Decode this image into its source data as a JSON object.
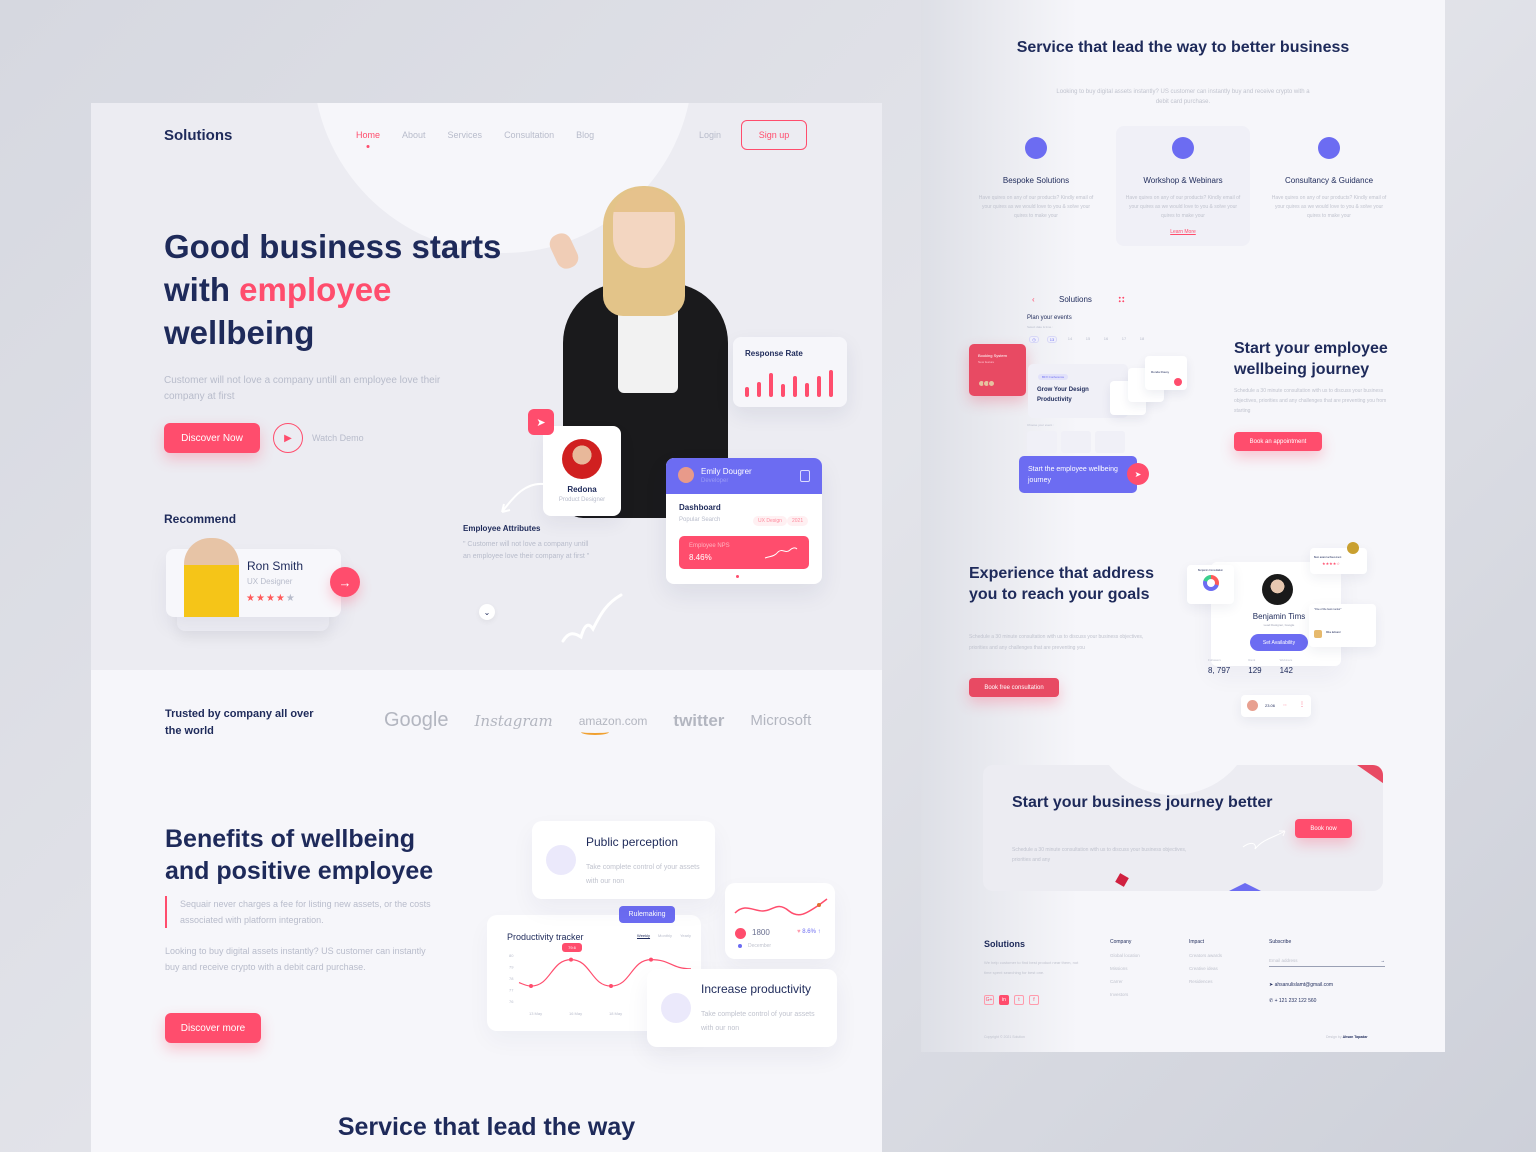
{
  "landing": {
    "logo": "Solutions",
    "nav": [
      {
        "label": "Home",
        "active": true
      },
      {
        "label": "About"
      },
      {
        "label": "Services"
      },
      {
        "label": "Consultation"
      },
      {
        "label": "Blog"
      }
    ],
    "login": "Login",
    "signup": "Sign up",
    "hero": {
      "title_part1": "Good business starts with ",
      "title_highlight": "employee",
      "title_part2": " wellbeing",
      "subtitle": "Customer will not love a company untill an employee love their company at first",
      "primary_button": "Discover Now",
      "watch_demo": "Watch Demo"
    },
    "recommend": {
      "heading": "Recommend",
      "name": "Ron Smith",
      "role": "UX Designer",
      "rating": 4,
      "rating_max": 5
    },
    "response_rate": {
      "title": "Response Rate",
      "bars": [
        0.35,
        0.55,
        0.85,
        0.45,
        0.75,
        0.5,
        0.75,
        0.95
      ]
    },
    "redona": {
      "name": "Redona",
      "role": "Product Designer"
    },
    "employee_attributes": {
      "title": "Employee Attributes",
      "text": "\" Customer will not love a company untill an employee love  their company at first \""
    },
    "emily_card": {
      "name": "Emily Dougrer",
      "role": "Developer",
      "section": "Dashboard",
      "popular": "Popular Search",
      "tags": [
        "UX Design",
        "2021"
      ],
      "nps_label": "Employee NPS",
      "nps_value": "8.46%"
    },
    "trusted": {
      "title": "Trusted by company all over the world",
      "brands": [
        "Google",
        "Instagram",
        "amazon.com",
        "twitter",
        "Microsoft"
      ]
    },
    "benefits": {
      "title": "Benefits of wellbeing and positive employee",
      "quote": "Sequair never charges a fee for listing new assets, or the costs associated with platform integration.",
      "text": "Looking to buy digital assets instantly? US customer can instantly buy and receive crypto with a debit card purchase.",
      "button": "Discover more",
      "public_perception": {
        "title": "Public perception",
        "text": "Take complete control of your assets with our non"
      },
      "rulemaking": "Rulemaking",
      "increase_productivity": {
        "title": "Increase productivity",
        "text": "Take complete control of your assets with our non"
      },
      "mini_stat": {
        "value": "1800",
        "change": "8.6%",
        "label": "December"
      }
    },
    "service_heading": "Service that lead the way"
  },
  "chart_data": {
    "type": "line",
    "title": "Productivity tracker",
    "tabs": [
      "Weekly",
      "Monthly",
      "Yearly"
    ],
    "active_tab": "Weekly",
    "x": [
      "13 May",
      "16 May",
      "18 May",
      "19 May"
    ],
    "y_ticks": [
      "80",
      "79",
      "78",
      "77",
      "76"
    ],
    "ylim": [
      76,
      80
    ],
    "series": [
      {
        "name": "Productivity",
        "values": [
          77.3,
          79.6,
          77.3,
          79.6,
          78.8
        ]
      }
    ],
    "highlight_label": "79.6"
  },
  "services": {
    "title": "Service that lead the way to better business",
    "subtitle": "Looking to buy digital assets instantly? US customer can instantly buy and receive crypto with a debit card purchase.",
    "items": [
      {
        "title": "Bespoke Solutions",
        "text": "Have quires on any of our products? Kindly email of your quires as we would love to you & solve your quires to make your"
      },
      {
        "title": "Workshop & Webinars",
        "text": "Have quires on any of our products? Kindly email of your quires as we would love to you & solve your quires to make your",
        "link": "Learn More"
      },
      {
        "title": "Consultancy & Guidance",
        "text": "Have quires on any of our products? Kindly email of your quires as we would love to you & solve your quires to make your"
      }
    ]
  },
  "app_mock": {
    "title": "Solutions",
    "plan": "Plan your events",
    "select": "Select date & time :",
    "dates": [
      "",
      "13",
      "14",
      "15",
      "16",
      "17",
      "18"
    ],
    "booking_title": "Booking System",
    "booking_sub": "New feature",
    "grow_tag": "BFX Conference",
    "grow_title": "Grow Your Design Productivity",
    "choose": "Choose your event :",
    "person": "Ronda Rousy",
    "cta": "Start the employee wellbeing journey"
  },
  "journey": {
    "title": "Start your employee wellbeing journey",
    "text": "Schedule a 30 minute consultation with us to discuss your business objectives, priorities and any challenges that are preventing you from starting",
    "button": "Book an appointment"
  },
  "experience": {
    "title": "Experience that address you to reach your goals",
    "text": "Schedule a 30 minute consultation with us to discuss your business objectives, priorities and any challenges that are preventing you",
    "button": "Book free consultation",
    "profile": {
      "name": "Benjamin Tims",
      "role": "Lead Designer, Google",
      "button": "Set Availability",
      "stats": [
        {
          "label": "Followers",
          "value": "8, 797"
        },
        {
          "label": "Rank",
          "value": "129"
        },
        {
          "label": "Webinars",
          "value": "142"
        }
      ]
    },
    "ring_title": "Benjamin Consultation",
    "award": "Best award achievement",
    "mentor_quote": "\"One of the best mentor\"",
    "mentor_name": "Mike Edward",
    "rating_value": "23.06"
  },
  "business_cta": {
    "title": "Start your business journey better",
    "text": "Schedule a 30 minute consultation with us to discuss your business objectives, priorities and any",
    "button": "Book now"
  },
  "footer": {
    "logo": "Solutions",
    "about": "We help customer to find best product near them, not time spent searching for best one.",
    "social": [
      "G+",
      "in",
      "t",
      "f"
    ],
    "company": {
      "heading": "Company",
      "items": [
        "Global location",
        "Missions",
        "Carrer",
        "Investors"
      ]
    },
    "impact": {
      "heading": "Impact",
      "items": [
        "Creators awards",
        "Creative ideas",
        "Residences"
      ]
    },
    "subscribe": {
      "heading": "Subscribe",
      "placeholder": "Email address"
    },
    "email": "ahsanulislamt@gmail.com",
    "phone": "+ 121  232  122   560",
    "copyright": "Copyright © 2021 Solution",
    "design_by_label": "Design by",
    "design_by": "Ahsan Tapadar"
  }
}
